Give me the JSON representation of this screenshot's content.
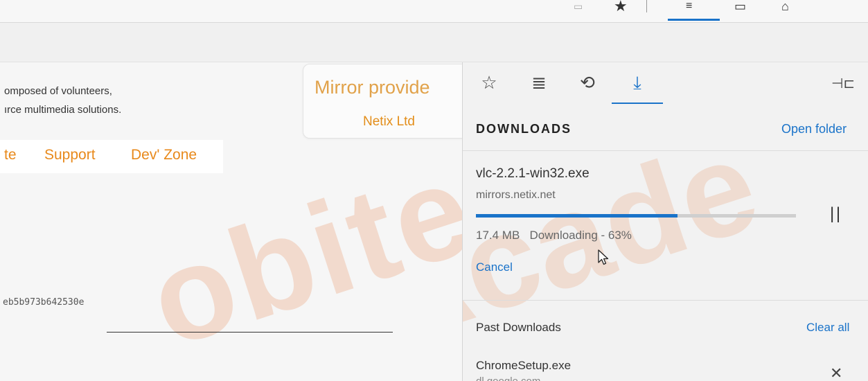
{
  "accent_color": "#1a73c9",
  "brand_color": "#e8891b",
  "toolbar": {
    "reading_view_icon": "reading-view-icon",
    "favorite_icon": "star-icon",
    "hub_icon": "hub-icon",
    "notes_icon": "notes-icon",
    "share_icon": "share-icon"
  },
  "page": {
    "intro_line1": "omposed of volunteers,",
    "intro_line2": "ırce multimedia solutions.",
    "mirror_title": "Mirror provide",
    "mirror_name": "Netix Ltd",
    "nav": [
      "te",
      "Support",
      "Dev' Zone"
    ],
    "hash": "eb5b973b642530e",
    "watermark": "obiteq Acade"
  },
  "panel": {
    "tabs": [
      {
        "name": "favorites",
        "icon": "star-icon"
      },
      {
        "name": "reading-list",
        "icon": "reading-list-icon"
      },
      {
        "name": "history",
        "icon": "history-icon"
      },
      {
        "name": "downloads",
        "icon": "download-icon",
        "active": true
      }
    ],
    "heading": "DOWNLOADS",
    "open_folder": "Open folder",
    "current": {
      "filename": "vlc-2.2.1-win32.exe",
      "source": "mirrors.netix.net",
      "size": "17.4 MB",
      "status": "Downloading - 63%",
      "progress": 0.63,
      "cancel": "Cancel"
    },
    "past_label": "Past Downloads",
    "clear_all": "Clear all",
    "past_items": [
      {
        "filename": "ChromeSetup.exe",
        "source": "dl.google.com"
      }
    ]
  }
}
